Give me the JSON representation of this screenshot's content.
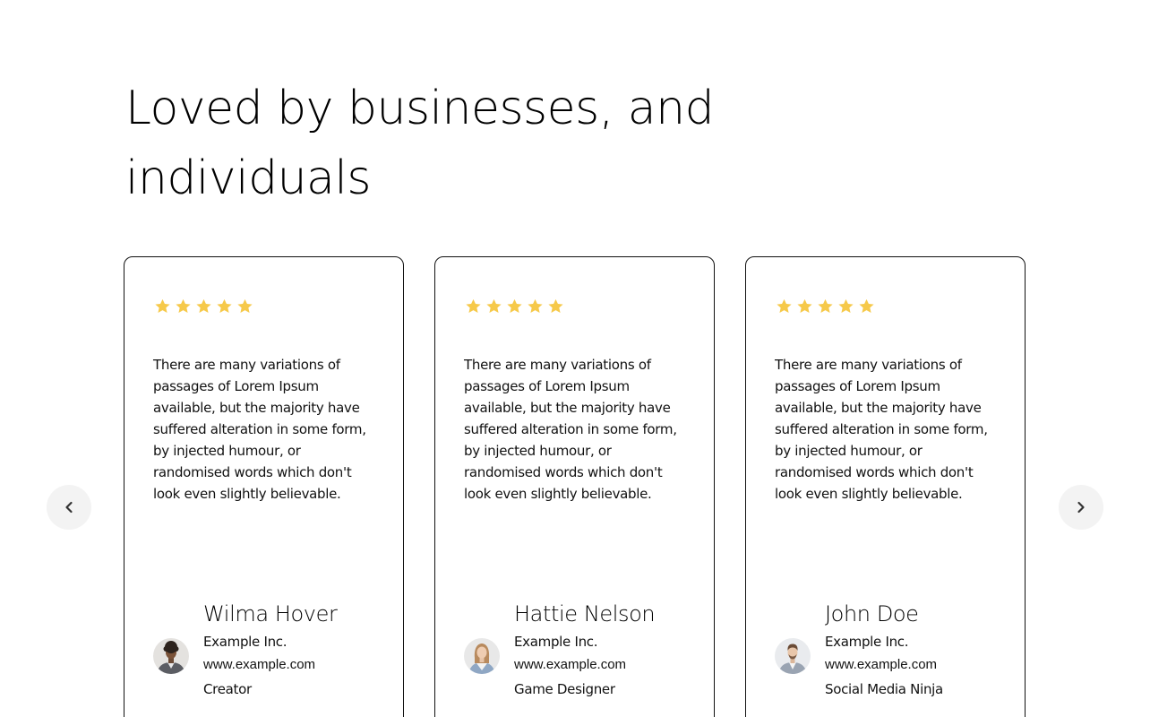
{
  "section": {
    "heading": "Loved by businesses, and individuals"
  },
  "colors": {
    "star": "#f6c94a",
    "card_border": "#111111",
    "nav_button_bg": "#f3f3f3"
  },
  "navigation": {
    "prev_icon": "chevron-left-icon",
    "next_icon": "chevron-right-icon"
  },
  "testimonials": [
    {
      "rating": 5,
      "quote": "There are many variations of passages of Lorem Ipsum available, but the majority have suffered alteration in some form, by injected humour, or randomised words which don't look even slightly believable.",
      "name": "Wilma Hover",
      "company": "Example Inc.",
      "website": "www.example.com",
      "role": "Creator"
    },
    {
      "rating": 5,
      "quote": "There are many variations of passages of Lorem Ipsum available, but the majority have suffered alteration in some form, by injected humour, or randomised words which don't look even slightly believable.",
      "name": "Hattie Nelson",
      "company": "Example Inc.",
      "website": "www.example.com",
      "role": "Game Designer"
    },
    {
      "rating": 5,
      "quote": "There are many variations of passages of Lorem Ipsum available, but the majority have suffered alteration in some form, by injected humour, or randomised words which don't look even slightly believable.",
      "name": "John Doe",
      "company": "Example Inc.",
      "website": "www.example.com",
      "role": "Social Media Ninja"
    }
  ]
}
